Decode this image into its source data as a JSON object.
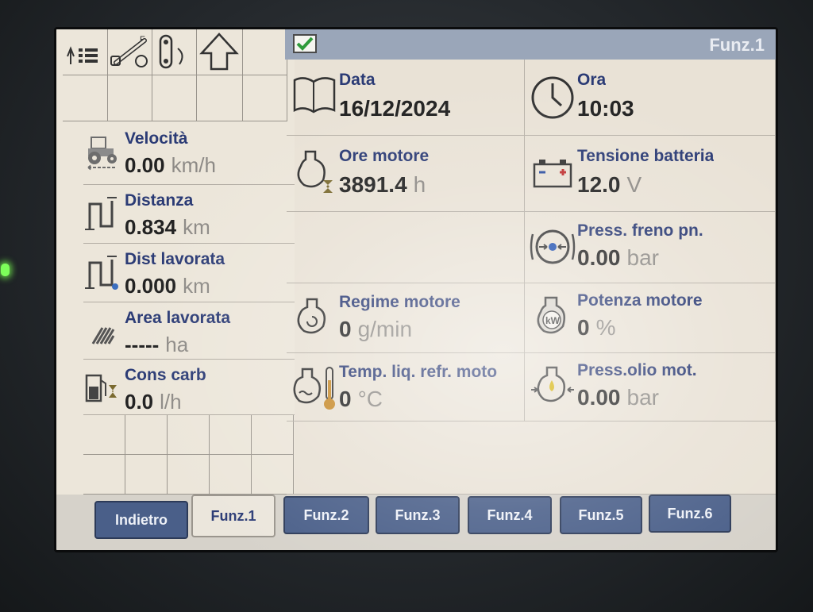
{
  "header": {
    "title": "Funz.1",
    "checkbox_checked": true
  },
  "left_panel": {
    "items": [
      {
        "label": "Velocità",
        "value": "0.00",
        "unit": "km/h",
        "icon": "tractor-speed-icon"
      },
      {
        "label": "Distanza",
        "value": "0.834",
        "unit": "km",
        "icon": "distance-icon"
      },
      {
        "label": "Dist lavorata",
        "value": "0.000",
        "unit": "km",
        "icon": "worked-distance-icon"
      },
      {
        "label": "Area lavorata",
        "value": "-----",
        "unit": "ha",
        "icon": "worked-area-icon"
      },
      {
        "label": "Cons carb",
        "value": "0.0",
        "unit": "l/h",
        "icon": "fuel-consumption-icon"
      }
    ]
  },
  "main": {
    "data": {
      "label": "Data",
      "value": "16/12/2024",
      "icon": "calendar-icon"
    },
    "ora": {
      "label": "Ora",
      "value": "10:03",
      "icon": "clock-icon"
    },
    "ore_motore": {
      "label": "Ore motore",
      "value": "3891.4",
      "unit": "h",
      "icon": "engine-hours-icon"
    },
    "tensione": {
      "label": "Tensione batteria",
      "value": "12.0",
      "unit": "V",
      "icon": "battery-icon"
    },
    "freno": {
      "label": "Press. freno pn.",
      "value": "0.00",
      "unit": "bar",
      "icon": "brake-pressure-icon"
    },
    "regime": {
      "label": "Regime motore",
      "value": "0",
      "unit": "g/min",
      "icon": "engine-rpm-icon"
    },
    "potenza": {
      "label": "Potenza motore",
      "value": "0",
      "unit": "%",
      "icon": "engine-power-icon"
    },
    "temp": {
      "label": "Temp. liq. refr. moto",
      "value": "0",
      "unit": "°C",
      "icon": "coolant-temp-icon"
    },
    "olio": {
      "label": "Press.olio mot.",
      "value": "0.00",
      "unit": "bar",
      "icon": "oil-pressure-icon"
    }
  },
  "tabs": [
    {
      "label": "Indietro"
    },
    {
      "label": "Funz.1"
    },
    {
      "label": "Funz.2"
    },
    {
      "label": "Funz.3"
    },
    {
      "label": "Funz.4"
    },
    {
      "label": "Funz.5"
    },
    {
      "label": "Funz.6"
    }
  ],
  "colors": {
    "label": "#2b3b75",
    "tab_bg": "#4a5f89",
    "header_bg": "#9aa6b9",
    "screen_bg": "#e9e2d6"
  }
}
